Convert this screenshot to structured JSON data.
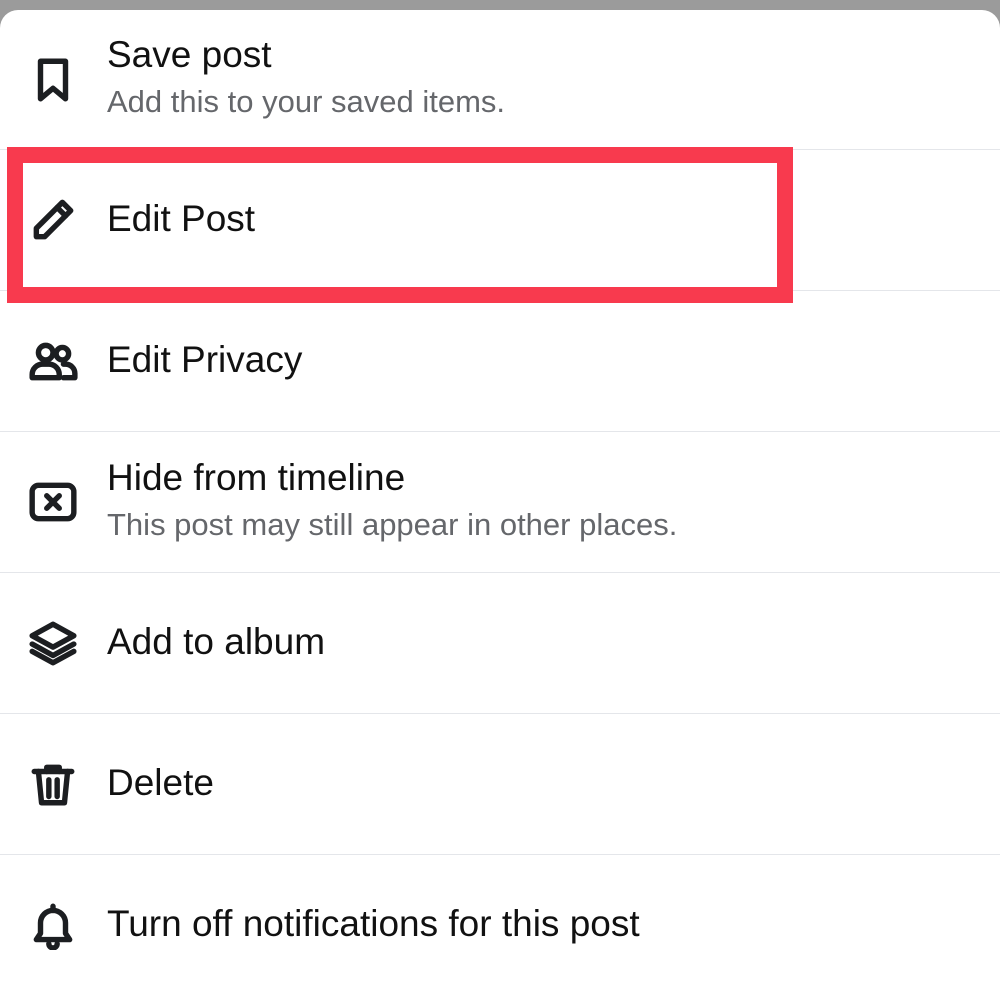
{
  "menu": {
    "items": [
      {
        "label": "Save post",
        "sub": "Add this to your saved items.",
        "icon": "bookmark-icon"
      },
      {
        "label": "Edit Post",
        "icon": "pencil-icon"
      },
      {
        "label": "Edit Privacy",
        "icon": "people-icon"
      },
      {
        "label": "Hide from timeline",
        "sub": "This post may still appear in other places.",
        "icon": "close-box-icon"
      },
      {
        "label": "Add to album",
        "icon": "layers-icon"
      },
      {
        "label": "Delete",
        "icon": "trash-icon"
      },
      {
        "label": "Turn off notifications for this post",
        "icon": "bell-icon"
      }
    ]
  },
  "colors": {
    "highlight": "#f83a4e",
    "backdrop": "#9b9b9b",
    "text": "#111111",
    "subtext": "#65676b"
  }
}
